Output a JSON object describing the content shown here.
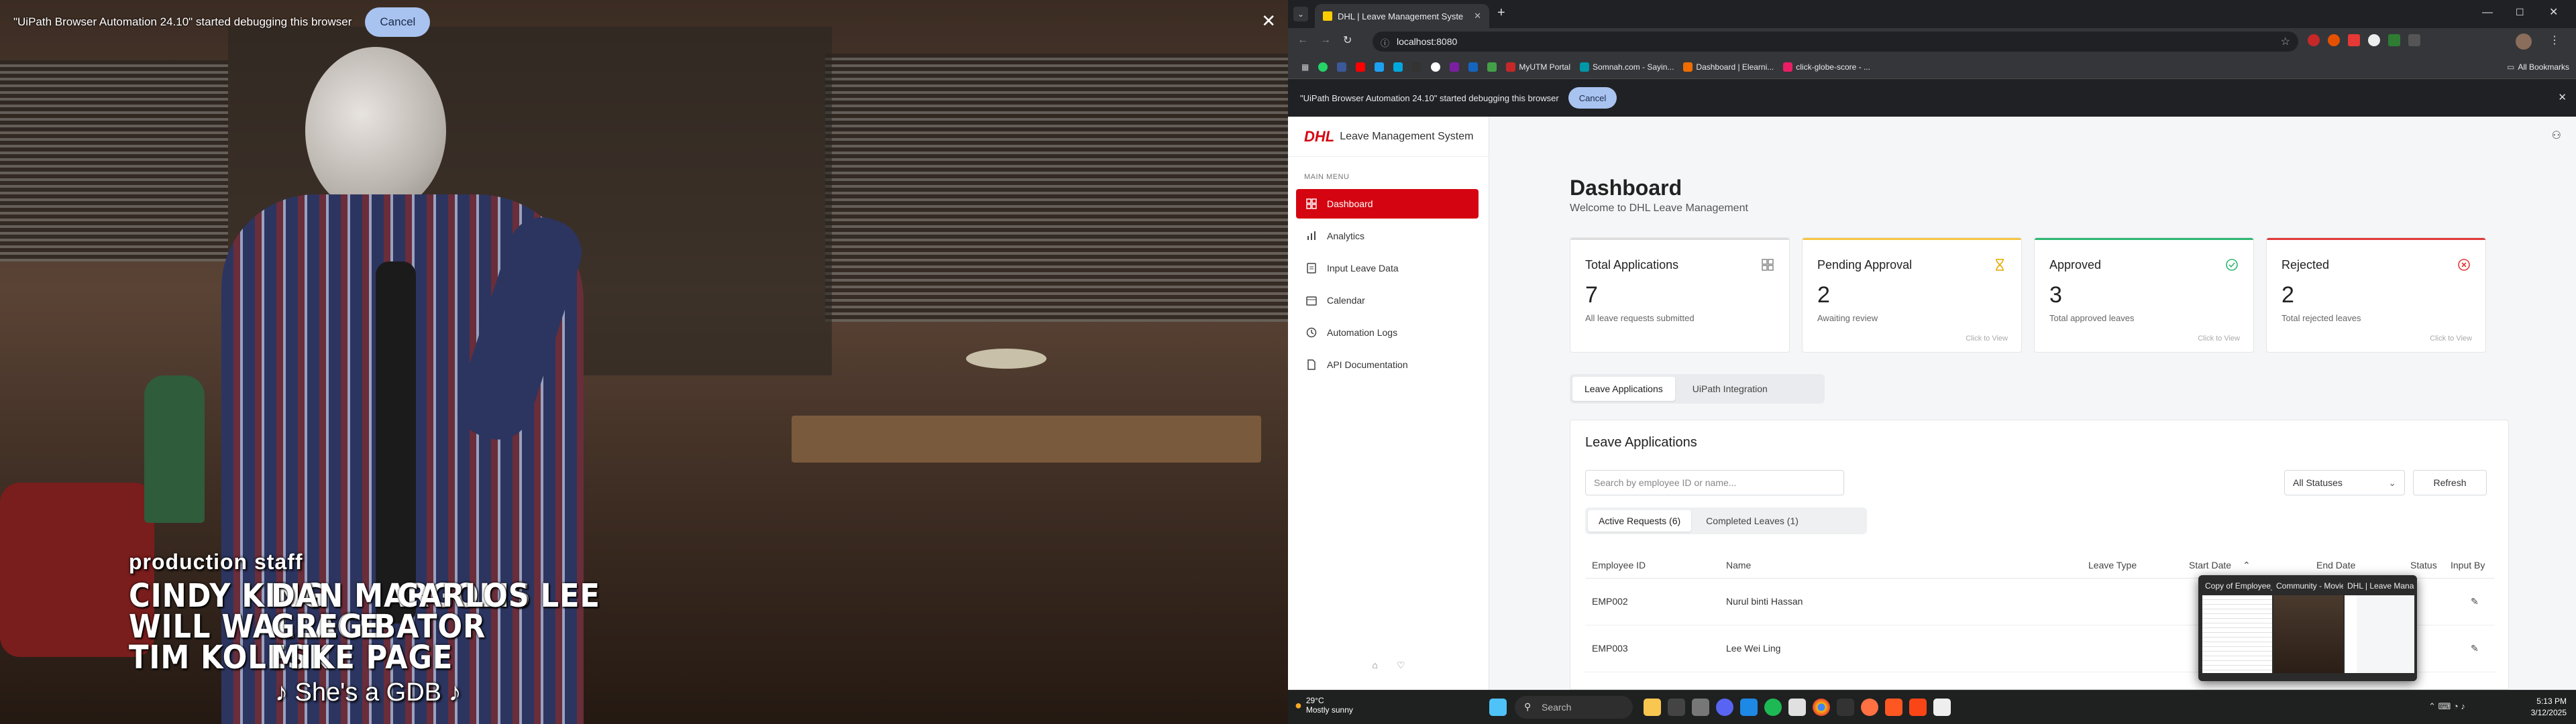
{
  "video": {
    "debug_message": "\"UiPath Browser Automation 24.10\" started debugging this browser",
    "cancel_label": "Cancel",
    "close_glyph": "✕",
    "credits": {
      "heading": "production staff",
      "col1": [
        "CINDY KING",
        "WILL WALLACE",
        "TIM KOLESK"
      ],
      "col2": [
        "DAN MARGOLIS",
        "GREG BATOR",
        "MIKE PAGE"
      ],
      "col3": [
        "CARLOS LEE"
      ],
      "subtitle": "♪ She's a GDB ♪"
    }
  },
  "browser": {
    "tab_title": "DHL | Leave Management Syste",
    "url": "localhost:8080",
    "bookmarks": [
      "MyUTM Portal",
      "Somnah.com - Sayin...",
      "Dashboard | Elearni...",
      "click-globe-score - ..."
    ],
    "all_bookmarks": "All Bookmarks",
    "infobar_message": "\"UiPath Browser Automation 24.10\" started debugging this browser",
    "infobar_cancel": "Cancel"
  },
  "app": {
    "brand": "DHL",
    "brand_title": "Leave Management System",
    "menu_heading": "MAIN MENU",
    "nav": [
      {
        "label": "Dashboard",
        "icon": "grid-icon"
      },
      {
        "label": "Analytics",
        "icon": "bar-chart-icon"
      },
      {
        "label": "Input Leave Data",
        "icon": "file-icon"
      },
      {
        "label": "Calendar",
        "icon": "calendar-icon"
      },
      {
        "label": "Automation Logs",
        "icon": "clock-icon"
      },
      {
        "label": "API Documentation",
        "icon": "doc-icon"
      }
    ],
    "title": "Dashboard",
    "subtitle": "Welcome to DHL Leave Management",
    "cards": [
      {
        "title": "Total Applications",
        "value": "7",
        "sub": "All leave requests submitted",
        "link": "",
        "color": "#dddddd"
      },
      {
        "title": "Pending Approval",
        "value": "2",
        "sub": "Awaiting review",
        "link": "Click to View",
        "color": "#f5c542"
      },
      {
        "title": "Approved",
        "value": "3",
        "sub": "Total approved leaves",
        "link": "Click to View",
        "color": "#2eb872"
      },
      {
        "title": "Rejected",
        "value": "2",
        "sub": "Total rejected leaves",
        "link": "Click to View",
        "color": "#e03a3a"
      }
    ],
    "tabs": [
      "Leave Applications",
      "UiPath Integration"
    ],
    "panel_title": "Leave Applications",
    "search_placeholder": "Search by employee ID or name...",
    "status_filter": "All Statuses",
    "refresh_label": "Refresh",
    "subtabs": [
      "Active Requests (6)",
      "Completed Leaves (1)"
    ],
    "columns": [
      "Employee ID",
      "Name",
      "Leave Type",
      "Start Date",
      "End Date",
      "Status",
      "Input By"
    ],
    "rows": [
      {
        "id": "EMP002",
        "name": "Nurul binti Hassan"
      },
      {
        "id": "EMP003",
        "name": "Lee Wei Ling"
      }
    ],
    "fab_label": "+"
  },
  "taskbar": {
    "temp": "29°C",
    "weather": "Mostly sunny",
    "search": "Search",
    "time": "5:13 PM",
    "date": "3/12/2025",
    "previews": [
      {
        "title": "Copy of Employee_Leave_D..."
      },
      {
        "title": "Community - Moviebox - G..."
      },
      {
        "title": "DHL | Leave Manage..."
      }
    ]
  }
}
